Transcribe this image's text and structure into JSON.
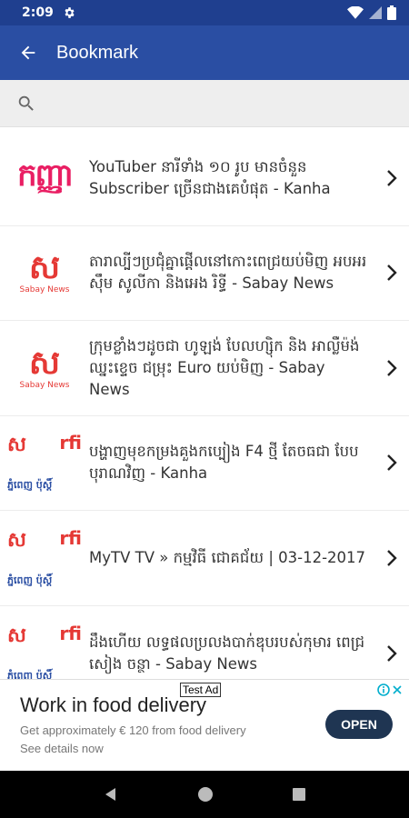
{
  "status_bar": {
    "time": "2:09"
  },
  "app_bar": {
    "title": "Bookmark"
  },
  "search": {
    "placeholder": ""
  },
  "items": [
    {
      "title": "YouTuber នារីទាំង ១០ រូប មានចំនួន Subscriber ច្រើនជាងគេបំផុត - Kanha",
      "logo": "kanha"
    },
    {
      "title": "តារាល្បីៗប្រជុំគ្នាផ្តើលនៅកោះពេជ្រយប់មិញ អបអរ ស៊ឹម សូលីកា និងអេង រិទ្ធី - Sabay News",
      "logo": "sabay"
    },
    {
      "title": "ក្រុមខ្លាំងៗដូចជា ហូឡង់ បែលហ្ស៊ិក និង អាល្លឺម៉ង់ឈ្នះខ្ទេច ជម្រុះ Euro យប់មិញ - Sabay News",
      "logo": "sabay"
    },
    {
      "title": "បង្ហាញមុខកម្រងគួងកប្បៀង F4 ថ្មី តែចធជា បែបបុរាណវិញ - Kanha",
      "logo": "multi"
    },
    {
      "title": "MyTV TV » កម្មវិធី ជោគជ័យ | 03-12-2017",
      "logo": "multi"
    },
    {
      "title": "ដឹងហើយ លទ្ធផលប្រលងបាក់ឌុបរបស់កុមារ ពេជ្រ សៀង ចន្ថា - Sabay News",
      "logo": "multi"
    }
  ],
  "logos": {
    "kanha": "កញ្ញា",
    "sabay_mark": "ស",
    "sabay_caption": "Sabay News",
    "rfi": "rfi",
    "phnom_penh": "ភ្នំពេញ ប៉ុស្តិ៍"
  },
  "ad": {
    "tag": "Test Ad",
    "headline": "Work in food delivery",
    "body": "Get approximately € 120 from food delivery",
    "sub": "See details now",
    "cta": "OPEN"
  },
  "colors": {
    "status": "#1f3f8f",
    "appbar": "#2a4ea3",
    "kanha": "#e91e63",
    "sabay": "#e53935"
  }
}
